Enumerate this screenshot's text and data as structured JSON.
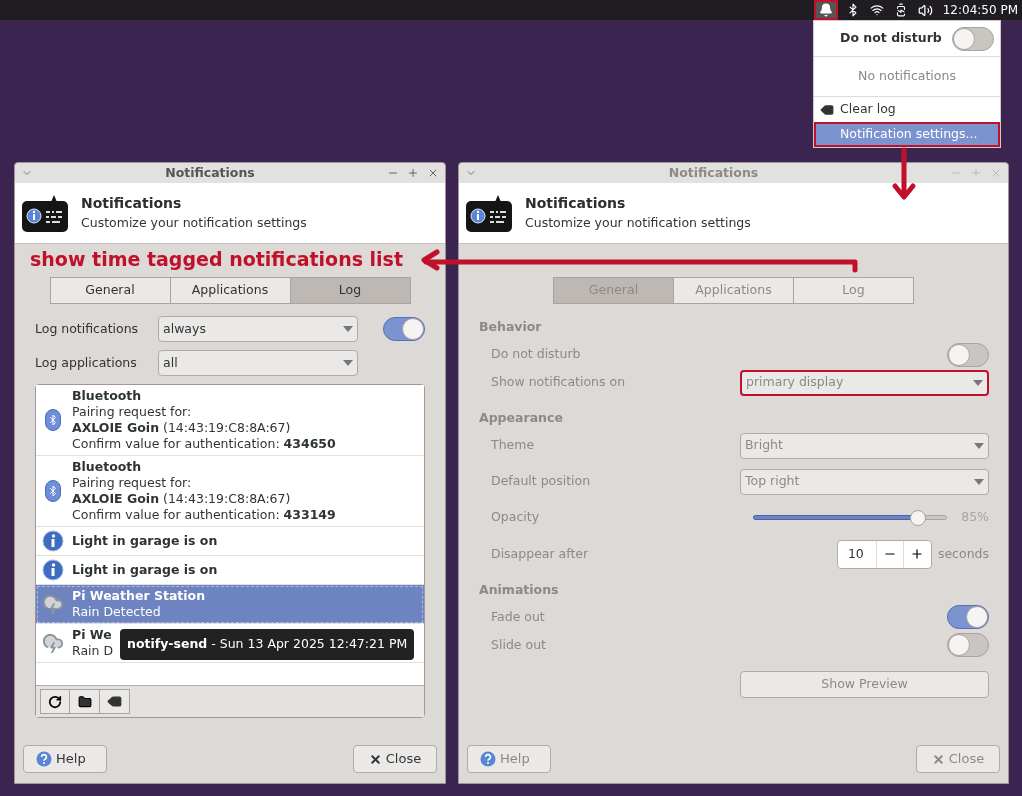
{
  "panel": {
    "clock": "12:04:50 PM",
    "bell_highlighted": true
  },
  "tray_menu": {
    "dnd_label": "Do not disturb",
    "dnd_on": false,
    "empty": "No notifications",
    "items": [
      {
        "kind": "clear",
        "label": "Clear log",
        "selected": false,
        "highlighted": false
      },
      {
        "kind": "settings",
        "label": "Notification settings...",
        "selected": true,
        "highlighted": true
      }
    ]
  },
  "annotation": {
    "text": "show time tagged notifications list"
  },
  "windows": [
    {
      "title": "Notifications",
      "active": true,
      "heading": "Notifications",
      "subheading": "Customize your notification settings",
      "tabs": [
        {
          "label": "General",
          "selected": false
        },
        {
          "label": "Applications",
          "selected": false
        },
        {
          "label": "Log",
          "selected": true
        }
      ],
      "page": {
        "kind": "log",
        "settings": [
          {
            "label": "Log notifications",
            "value": "always",
            "toggle": {
              "on": true
            }
          },
          {
            "label": "Log applications",
            "value": "all"
          }
        ],
        "entries": [
          {
            "kind": "bluetooth",
            "title": "Bluetooth",
            "lines": [
              "Pairing request for:",
              "**AXLOIE Goin** (14:43:19:C8:8A:67)",
              "Confirm value for authentication: **434650**"
            ],
            "selected": false
          },
          {
            "kind": "bluetooth",
            "title": "Bluetooth",
            "lines": [
              "Pairing request for:",
              "**AXLOIE Goin** (14:43:19:C8:8A:67)",
              "Confirm value for authentication: **433149**"
            ],
            "selected": false
          },
          {
            "kind": "info",
            "title": "Light in garage is on",
            "selected": false
          },
          {
            "kind": "info",
            "title": "Light in garage is on",
            "selected": false
          },
          {
            "kind": "weather",
            "title": "Pi Weather Station",
            "lines": [
              "Rain Detected"
            ],
            "selected": true
          },
          {
            "kind": "weather",
            "title": "Pi We",
            "lines": [
              "Rain D"
            ],
            "selected": false
          }
        ],
        "tooltip": "**notify-send** - Sun 13 Apr 2025 12:47:21 PM"
      },
      "buttons": [
        {
          "kind": "help",
          "label": "Help"
        },
        {
          "kind": "close",
          "label": "Close"
        }
      ]
    },
    {
      "title": "Notifications",
      "active": false,
      "heading": "Notifications",
      "subheading": "Customize your notification settings",
      "tabs": [
        {
          "label": "General",
          "selected": true
        },
        {
          "label": "Applications",
          "selected": false
        },
        {
          "label": "Log",
          "selected": false
        }
      ],
      "page": {
        "kind": "general",
        "sections": [
          {
            "title": "Behavior",
            "rows": [
              {
                "kind": "toggle",
                "label": "Do not disturb",
                "on": false
              },
              {
                "kind": "select",
                "label": "Show notifications on",
                "value": "primary display",
                "highlighted": true
              }
            ]
          },
          {
            "title": "Appearance",
            "rows": [
              {
                "kind": "select",
                "label": "Theme",
                "value": "Bright",
                "highlighted": false
              },
              {
                "kind": "select",
                "label": "Default position",
                "value": "Top right",
                "highlighted": false
              },
              {
                "kind": "slider",
                "label": "Opacity",
                "level": 0.85,
                "reading": "85%"
              },
              {
                "kind": "spin",
                "label": "Disappear after",
                "value": "10",
                "unit": "seconds"
              }
            ]
          },
          {
            "title": "Animations",
            "rows": [
              {
                "kind": "toggle",
                "label": "Fade out",
                "on": true
              },
              {
                "kind": "toggle",
                "label": "Slide out",
                "on": false
              }
            ]
          }
        ],
        "preview": "Show Preview"
      },
      "buttons": [
        {
          "kind": "help",
          "label": "Help"
        },
        {
          "kind": "close",
          "label": "Close"
        }
      ]
    }
  ]
}
